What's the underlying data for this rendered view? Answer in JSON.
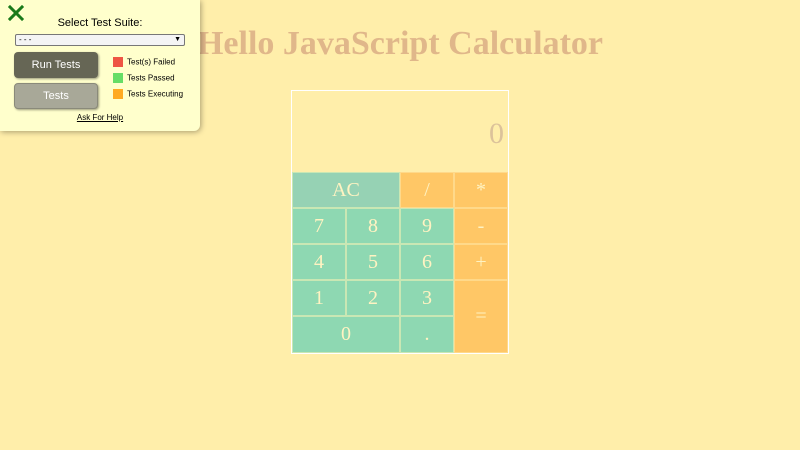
{
  "app": {
    "title": "Hello JavaScript Calculator"
  },
  "calculator": {
    "display": "0",
    "keys": {
      "clear": "AC",
      "divide": "/",
      "multiply": "*",
      "seven": "7",
      "eight": "8",
      "nine": "9",
      "subtract": "-",
      "four": "4",
      "five": "5",
      "six": "6",
      "add": "+",
      "one": "1",
      "two": "2",
      "three": "3",
      "equals": "=",
      "zero": "0",
      "decimal": "."
    }
  },
  "test_panel": {
    "suite_label": "Select Test Suite:",
    "suite_selected": "- - -",
    "run_button": "Run Tests",
    "tests_button": "Tests",
    "legend": [
      {
        "label": "Test(s) Failed",
        "color": "#ee5544"
      },
      {
        "label": "Tests Passed",
        "color": "#66dd66"
      },
      {
        "label": "Tests Executing",
        "color": "#ffaa22"
      }
    ],
    "help_link": "Ask For Help"
  },
  "colors": {
    "background": "#ffeeaa",
    "number_key": "#8ed8b2",
    "operator_key": "#ffc766",
    "close_icon": "#1a7a1a"
  }
}
